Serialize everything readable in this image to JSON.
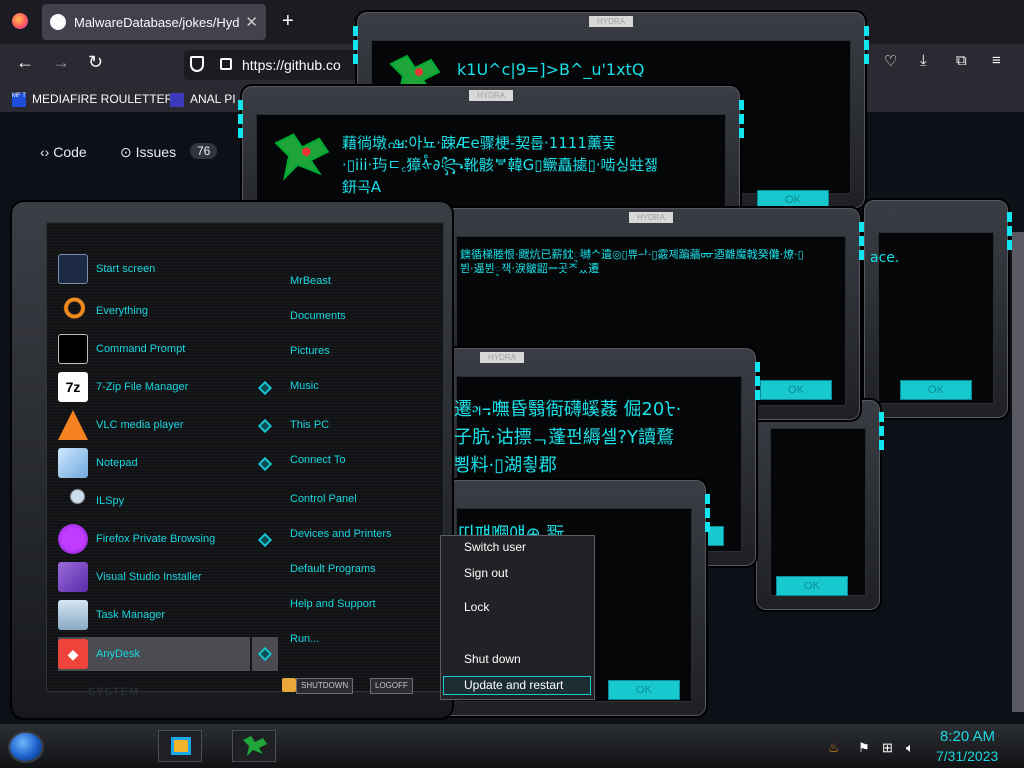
{
  "browser": {
    "tab_title": "MalwareDatabase/jokes/Hydra",
    "new_tab": "+",
    "tab_close": "✕",
    "url": "https://github.co",
    "bookmarks": [
      {
        "label": "MEDIAFIRE ROULETTER",
        "icon": "MF T"
      },
      {
        "label": "ANAL PI"
      }
    ],
    "nav": {
      "code": "Code",
      "issues": "Issues",
      "issues_count": "76"
    }
  },
  "hydra": {
    "title": "HYDRA",
    "ok": "OK",
    "messages": [
      "k1U^c|9=]>B^_u'1xtQ",
      "藉徜墩ഷ:아뇨·踈Æe骤梗-契룹·1111薰픛\n·▯iii·玙ㄷ꜀獐ᢤ∂꧂靴骸ᄫ韓G▯鳜矗㨿▯·啮싱蛀젫\n鈃곡A",
      "ace.",
      "鐭循梯塍恨·颼炕已薪鈂ᢩ嚩ᄉ遺◎▯쀼ᅪ·▯霰졔蹁蘠ᡂ迺䨈魔戟癸儺·燎·▯\n뷘·逼뷘ᢩ잭·淚皺鼦ᆖ곳ᄌᆻ遷",
      "遷ᤆ꓾嘸昏翳衙礴螇葌 倔20ᡶ·\n子肮·诂摽ᆨ蓬펀縟셀?Y讀鶩\n뾩料·▯湖쵷郡",
      "띠퍠嗰얘⊕ 翫"
    ]
  },
  "start_menu": {
    "programs": [
      {
        "label": "Start screen",
        "icon": "start-screen-icon"
      },
      {
        "label": "Everything",
        "icon": "magnifier-icon"
      },
      {
        "label": "Command Prompt",
        "icon": "cmd-icon"
      },
      {
        "label": "7-Zip File Manager",
        "icon": "7zip-icon",
        "arrow": true
      },
      {
        "label": "VLC media player",
        "icon": "vlc-cone-icon",
        "arrow": true
      },
      {
        "label": "Notepad",
        "icon": "notepad-icon",
        "arrow": true
      },
      {
        "label": "ILSpy",
        "icon": "ilspy-icon"
      },
      {
        "label": "Firefox Private Browsing",
        "icon": "firefox-private-icon",
        "arrow": true
      },
      {
        "label": "Visual Studio Installer",
        "icon": "vs-installer-icon"
      },
      {
        "label": "Task Manager",
        "icon": "task-manager-icon"
      },
      {
        "label": "AnyDesk",
        "icon": "anydesk-icon",
        "arrow": true,
        "highlighted": true
      }
    ],
    "places": [
      "MrBeast",
      "Documents",
      "Pictures",
      "Music",
      "This PC",
      "Connect To",
      "Control Panel",
      "Devices and Printers",
      "Default Programs",
      "Help and Support",
      "Run..."
    ],
    "shutdown": "SHUTDOWN",
    "logoff": "LOGOFF",
    "system_label": "SYSTEM"
  },
  "power_menu": {
    "items": [
      "Switch user",
      "Sign out",
      "Lock",
      "Shut down",
      "Update and restart"
    ],
    "selected": "Update and restart"
  },
  "taskbar": {
    "time": "8:20 AM",
    "date": "7/31/2023"
  },
  "colors": {
    "accent": "#19d6e0",
    "ok_button": "#17c8ce"
  }
}
